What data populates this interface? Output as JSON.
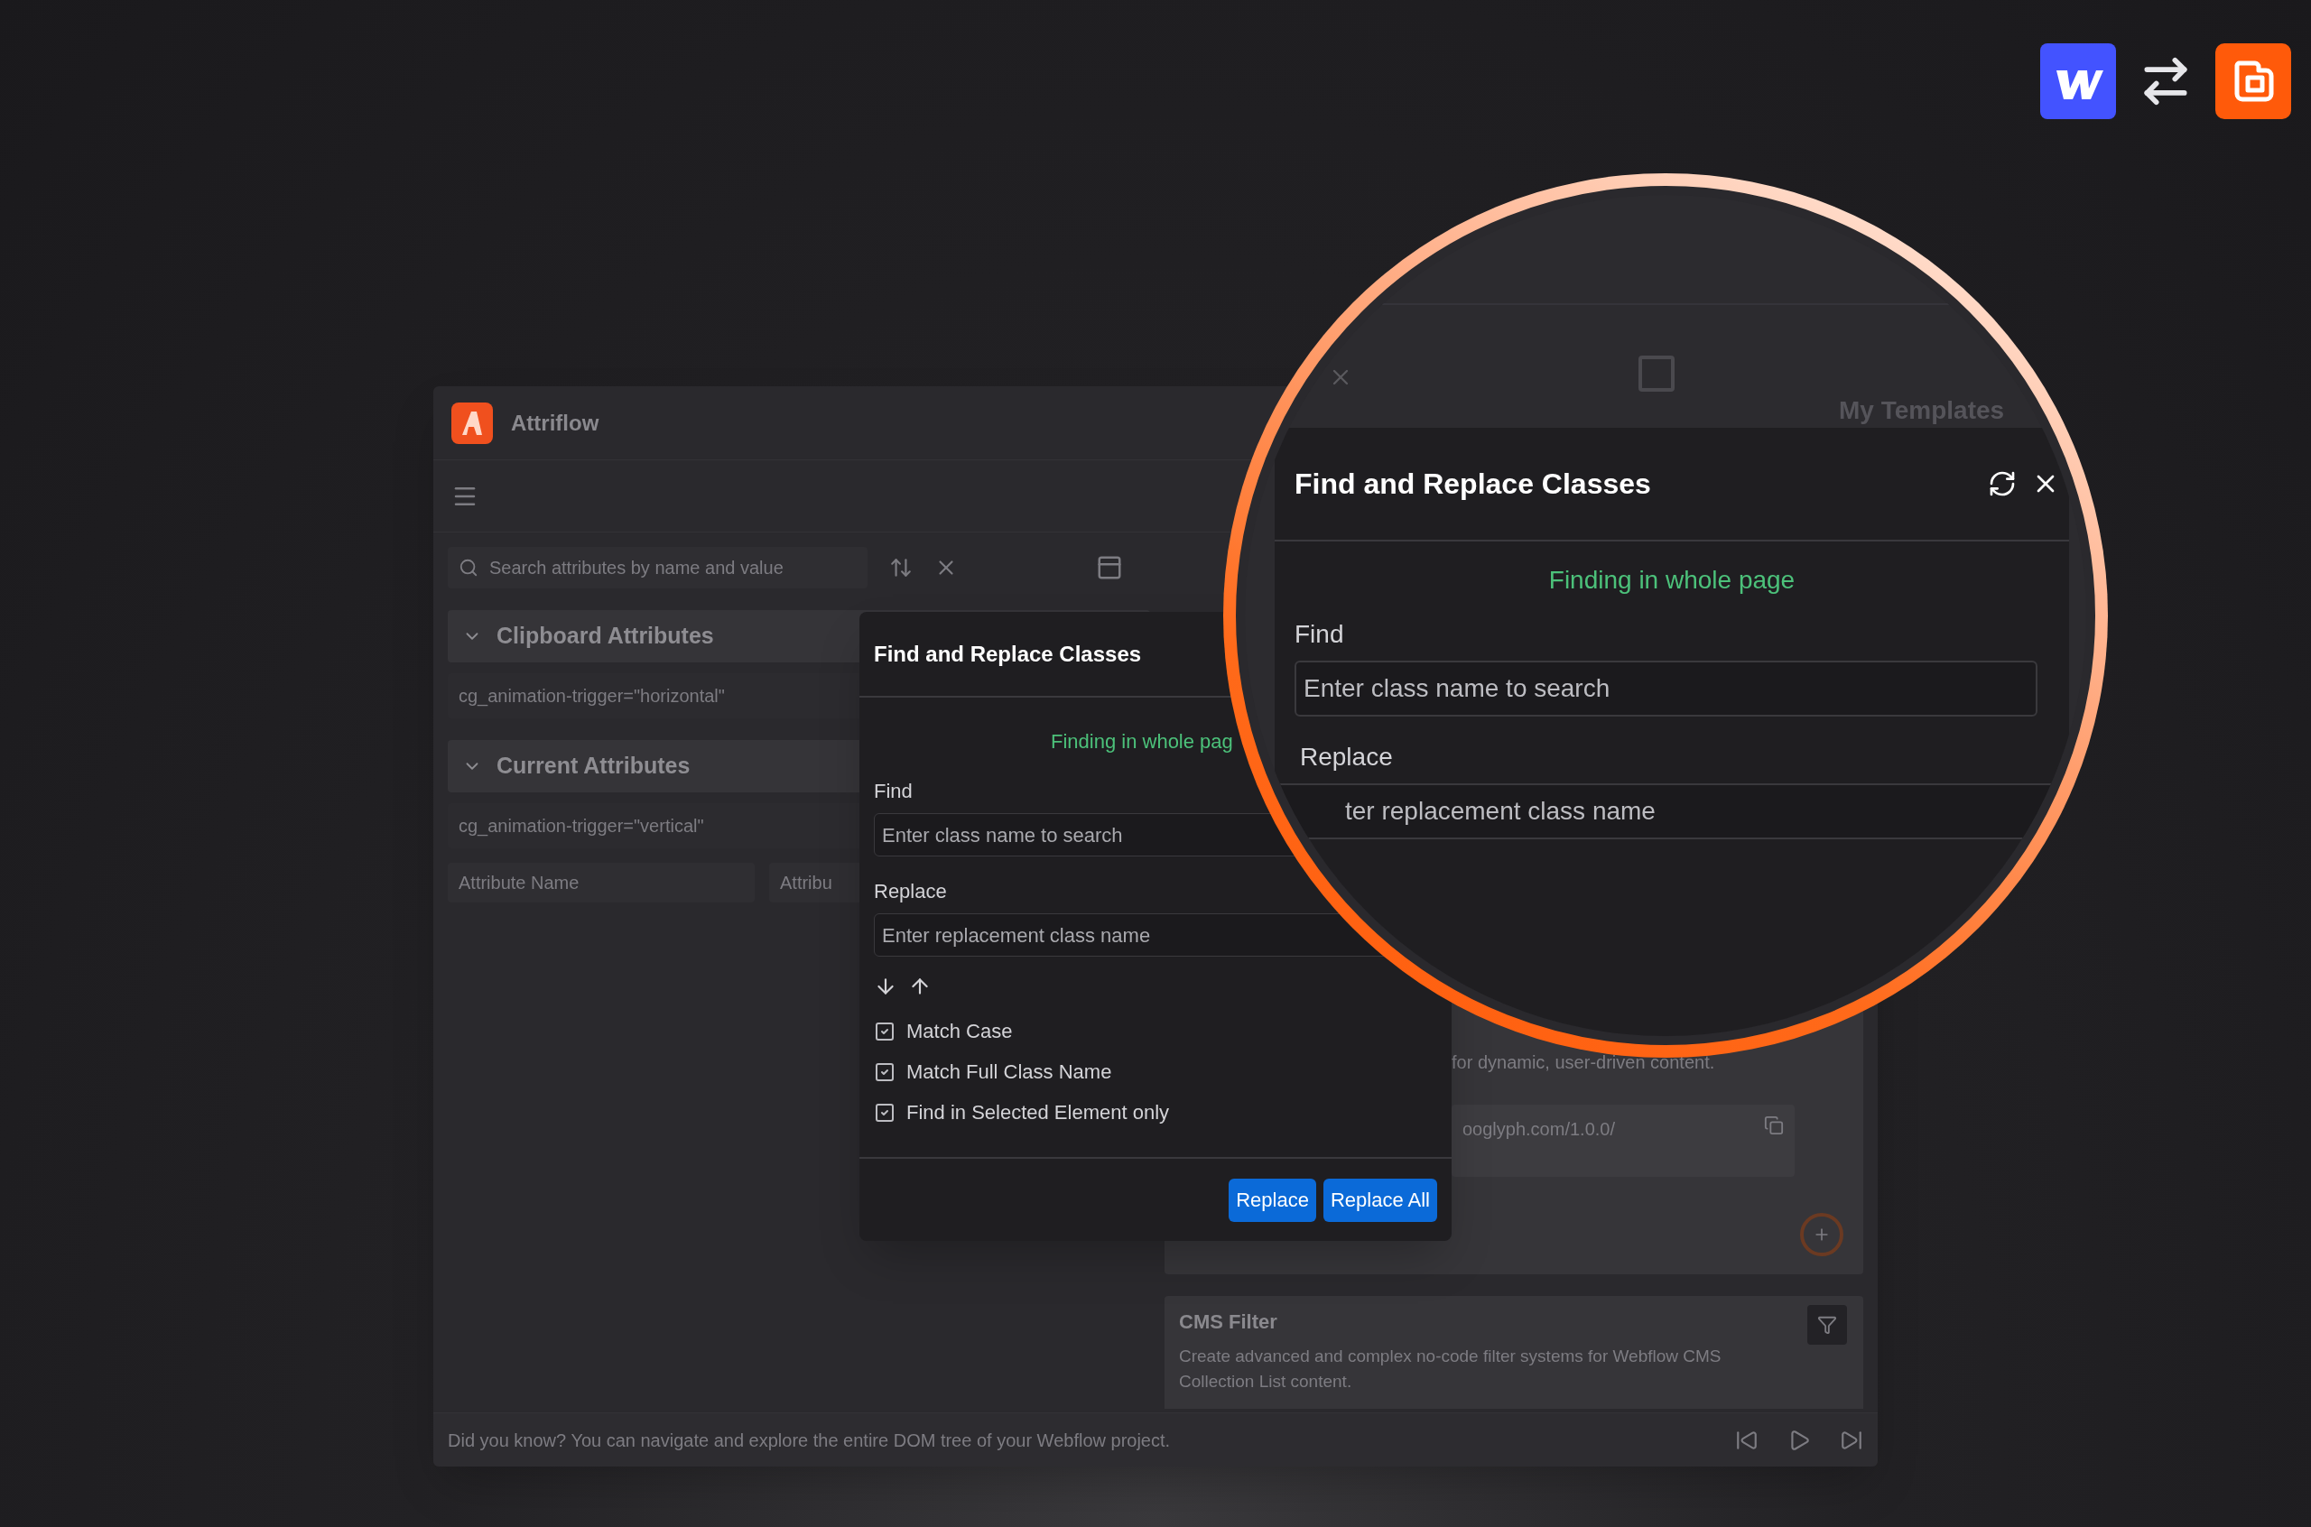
{
  "app": {
    "title": "Attriflow",
    "search": {
      "placeholder": "Search attributes by name and value"
    },
    "sections": [
      {
        "title": "Clipboard Attributes",
        "expanded": true,
        "items": [
          "cg_animation-trigger=\"horizontal\""
        ]
      },
      {
        "title": "Current Attributes",
        "expanded": true,
        "items": [
          "cg_animation-trigger=\"vertical\""
        ]
      }
    ],
    "attribute_fields": [
      {
        "placeholder": "Attribute Name"
      },
      {
        "placeholder": "Attribu"
      }
    ],
    "cards": [
      {
        "kind": "partial",
        "text": "for dynamic, user-driven content.",
        "url": "ooglyph.com/1.0.0/"
      },
      {
        "kind": "full",
        "title": "CMS Filter",
        "text": "Create advanced and complex no-code filter systems for Webflow CMS Collection List content."
      }
    ],
    "status": "Did you know? You can navigate and explore the entire DOM tree of your Webflow project."
  },
  "dialog": {
    "title": "Find and Replace Classes",
    "scope": "Finding in whole pag",
    "find_label": "Find",
    "find_placeholder": "Enter class name to search",
    "replace_label": "Replace",
    "replace_placeholder": "Enter replacement class name",
    "options": [
      {
        "label": "Match Case",
        "checked": true
      },
      {
        "label": "Match Full Class Name",
        "checked": true
      },
      {
        "label": "Find in Selected Element only",
        "checked": true
      }
    ],
    "buttons": [
      "Replace",
      "Replace All"
    ]
  },
  "magnifier": {
    "templates_tab": "My Templates",
    "title": "Find and Replace Classes",
    "scope": "Finding in whole page",
    "find_label": "Find",
    "find_placeholder": "Enter class name to search",
    "replace_label": "Replace",
    "replace_placeholder": "ter replacement class name"
  }
}
